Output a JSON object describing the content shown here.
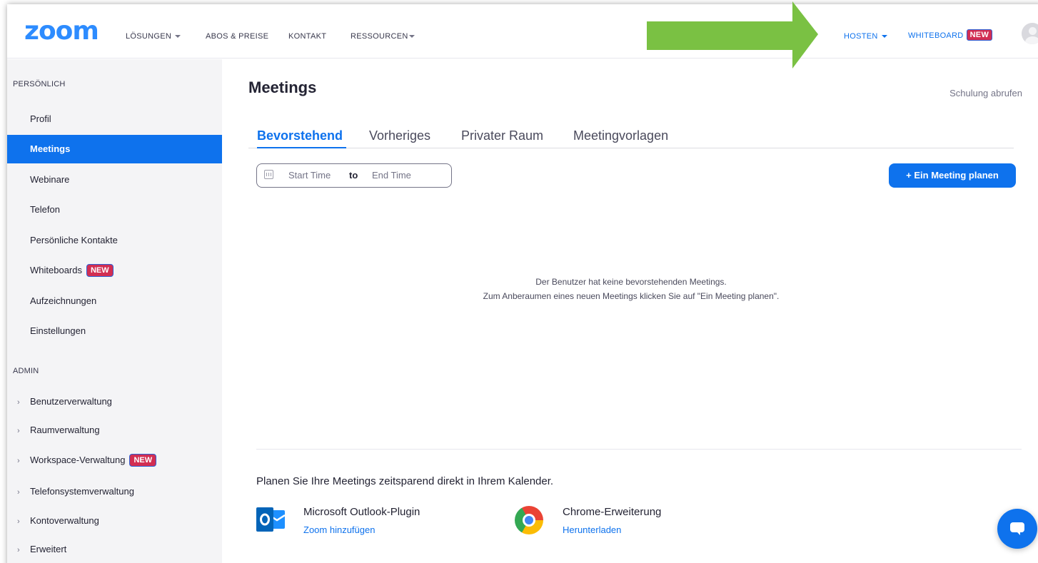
{
  "brand": {
    "logo": "zoom",
    "accent_color": "#0e72ed",
    "badge_color": "#d22e52"
  },
  "topnav": {
    "left_items": [
      {
        "label": "LÖSUNGEN",
        "has_caret": true
      },
      {
        "label": "ABOS & PREISE",
        "has_caret": false
      },
      {
        "label": "KONTAKT",
        "has_caret": false
      },
      {
        "label": "RESSOURCEN",
        "has_caret": true
      }
    ],
    "host_label": "HOSTEN",
    "whiteboard_label": "WHITEBOARD",
    "new_badge": "NEW",
    "avatar_icon": "user-avatar-icon"
  },
  "annotation": {
    "arrow_color": "#7ac143",
    "arrow_icon": "arrow-right-icon"
  },
  "sidebar": {
    "personal_header": "PERSÖNLICH",
    "items": [
      {
        "label": "Profil"
      },
      {
        "label": "Meetings",
        "active": true
      },
      {
        "label": "Webinare"
      },
      {
        "label": "Telefon"
      },
      {
        "label": "Persönliche Kontakte"
      },
      {
        "label": "Whiteboards",
        "badge": "NEW"
      },
      {
        "label": "Aufzeichnungen"
      },
      {
        "label": "Einstellungen"
      }
    ],
    "admin_header": "ADMIN",
    "admin_items": [
      {
        "label": "Benutzerverwaltung"
      },
      {
        "label": "Raumverwaltung"
      },
      {
        "label": "Workspace-Verwaltung",
        "badge": "NEW"
      },
      {
        "label": "Telefonsystemverwaltung"
      },
      {
        "label": "Kontoverwaltung"
      },
      {
        "label": "Erweitert"
      }
    ]
  },
  "main": {
    "title": "Meetings",
    "training_link": "Schulung abrufen",
    "tabs": [
      {
        "label": "Bevorstehend",
        "active": true
      },
      {
        "label": "Vorheriges"
      },
      {
        "label": "Privater Raum"
      },
      {
        "label": "Meetingvorlagen"
      }
    ],
    "date_range": {
      "icon": "calendar-icon",
      "start_placeholder": "Start Time",
      "separator": "to",
      "end_placeholder": "End Time"
    },
    "plan_button": "+  Ein Meeting planen",
    "empty_line1": "Der Benutzer hat keine bevorstehenden Meetings.",
    "empty_line2": "Zum Anberaumen eines neuen Meetings klicken Sie auf \"Ein Meeting planen\".",
    "calendar_title": "Planen Sie Ihre Meetings zeitsparend direkt in Ihrem Kalender.",
    "plugins": [
      {
        "icon": "outlook-icon",
        "name": "Microsoft Outlook-Plugin",
        "link": "Zoom hinzufügen"
      },
      {
        "icon": "chrome-icon",
        "name": "Chrome-Erweiterung",
        "link": "Herunterladen"
      }
    ]
  },
  "chat": {
    "icon": "chat-bubble-icon"
  }
}
